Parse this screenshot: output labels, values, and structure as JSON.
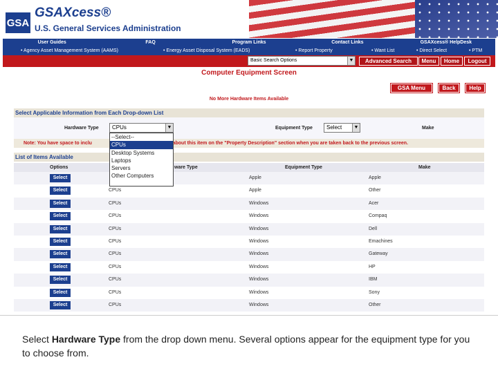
{
  "header": {
    "logo": "GSA",
    "brand": "GSAXcess®",
    "agency": "U.S. General Services Administration"
  },
  "nav": [
    "User Guides",
    "FAQ",
    "Program Links",
    "Contact Links",
    "GSAXcess® HelpDesk"
  ],
  "subnav": [
    "• Agency Asset Management System (AAMS)",
    "• Energy Asset Disposal System (EADS)",
    "• Report Property",
    "• Want List",
    "• Direct Select",
    "• PTM"
  ],
  "toolbar": {
    "basic_search": "Basic Search Options",
    "advanced": "Advanced Search",
    "menu": "Menu",
    "home": "Home",
    "logout": "Logout"
  },
  "page": {
    "title": "Computer Equipment Screen",
    "gsa_menu": "GSA Menu",
    "back": "Back",
    "help": "Help",
    "no_more": "No More Hardware Items Available"
  },
  "filters": {
    "heading": "Select Applicable Information from Each Drop-down List",
    "hardware_label": "Hardware Type",
    "hardware_value": "CPUs",
    "equipment_label": "Equipment Type",
    "equipment_value": "Select",
    "make_label": "Make"
  },
  "dropdown": {
    "options": [
      "--Select--",
      "CPUs",
      "Desktop Systems",
      "Laptops",
      "Servers",
      "Other Computers"
    ],
    "selected_index": 1
  },
  "note": {
    "left": "Note: You have space to inclu",
    "right": "ation about this item on the \"Property Description\" section when you are taken back to the previous screen."
  },
  "list": {
    "heading": "List of Items Available",
    "columns": [
      "Options",
      "ware Type",
      "Equipment Type",
      "Make"
    ],
    "select_label": "Select",
    "rows": [
      {
        "hw": "",
        "eq": "Apple",
        "make": "Apple"
      },
      {
        "hw": "CPUs",
        "eq": "Apple",
        "make": "Other"
      },
      {
        "hw": "CPUs",
        "eq": "Windows",
        "make": "Acer"
      },
      {
        "hw": "CPUs",
        "eq": "Windows",
        "make": "Compaq"
      },
      {
        "hw": "CPUs",
        "eq": "Windows",
        "make": "Dell"
      },
      {
        "hw": "CPUs",
        "eq": "Windows",
        "make": "Emachines"
      },
      {
        "hw": "CPUs",
        "eq": "Windows",
        "make": "Gateway"
      },
      {
        "hw": "CPUs",
        "eq": "Windows",
        "make": "HP"
      },
      {
        "hw": "CPUs",
        "eq": "Windows",
        "make": "IBM"
      },
      {
        "hw": "CPUs",
        "eq": "Windows",
        "make": "Sony"
      },
      {
        "hw": "CPUs",
        "eq": "Windows",
        "make": "Other"
      }
    ]
  },
  "caption": {
    "before": "Select ",
    "bold": "Hardware Type",
    "after": " from the drop down menu. Several options appear for the equipment type for you to choose from."
  },
  "colors": {
    "navy": "#1c3f8f",
    "red": "#c1181c"
  }
}
